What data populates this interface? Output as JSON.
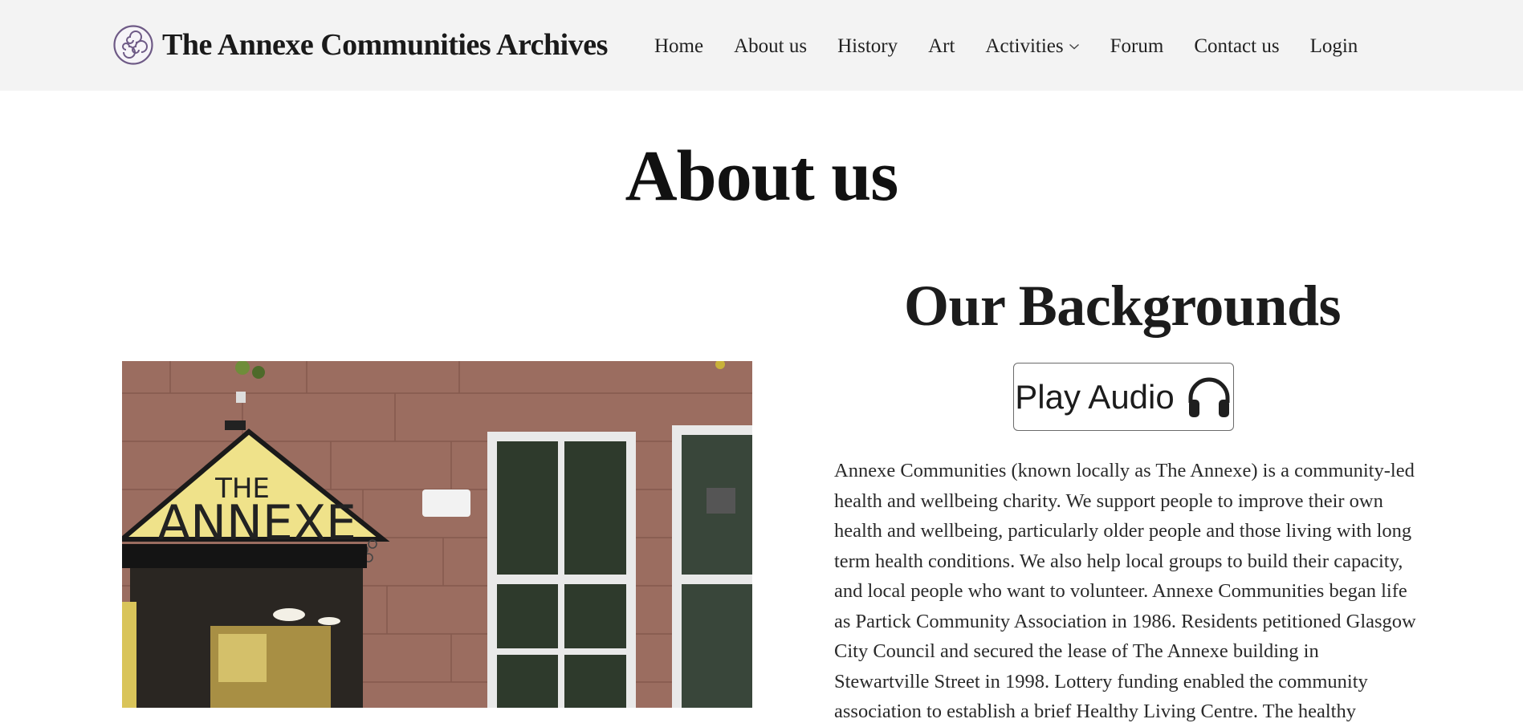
{
  "header": {
    "site_name": "The Annexe Communities Archives",
    "nav": [
      {
        "label": "Home"
      },
      {
        "label": "About us"
      },
      {
        "label": "History"
      },
      {
        "label": "Art"
      },
      {
        "label": "Activities"
      },
      {
        "label": "Forum"
      },
      {
        "label": "Contact us"
      },
      {
        "label": "Login"
      }
    ]
  },
  "main": {
    "page_title": "About us",
    "section_title": "Our Backgrounds",
    "audio_button_label": "Play Audio",
    "photo": {
      "sign_text_top": "THE",
      "sign_text_main": "ANNEXE"
    },
    "body_text": "Annexe Communities (known locally as The Annexe) is a community-led health and wellbeing charity. We support people to improve their own health and wellbeing, particularly older people and those living with long term health conditions. We also help local groups to build their capacity, and local people who want to volunteer. Annexe Communities began life as Partick Community Association in 1986. Residents petitioned Glasgow City Council and secured the lease of The Annexe building in Stewartville Street in 1998. Lottery funding enabled the community association to establish a brief Healthy Living Centre. The healthy"
  },
  "colors": {
    "header_bg": "#f3f3f3",
    "logo_purple": "#6e5a86",
    "sign_yellow": "#efe28a",
    "sandstone": "#9a6b5e"
  },
  "icons": {
    "logo": "triskele-icon",
    "activities_dropdown": "chevron-down-icon",
    "audio": "headphones-icon"
  }
}
